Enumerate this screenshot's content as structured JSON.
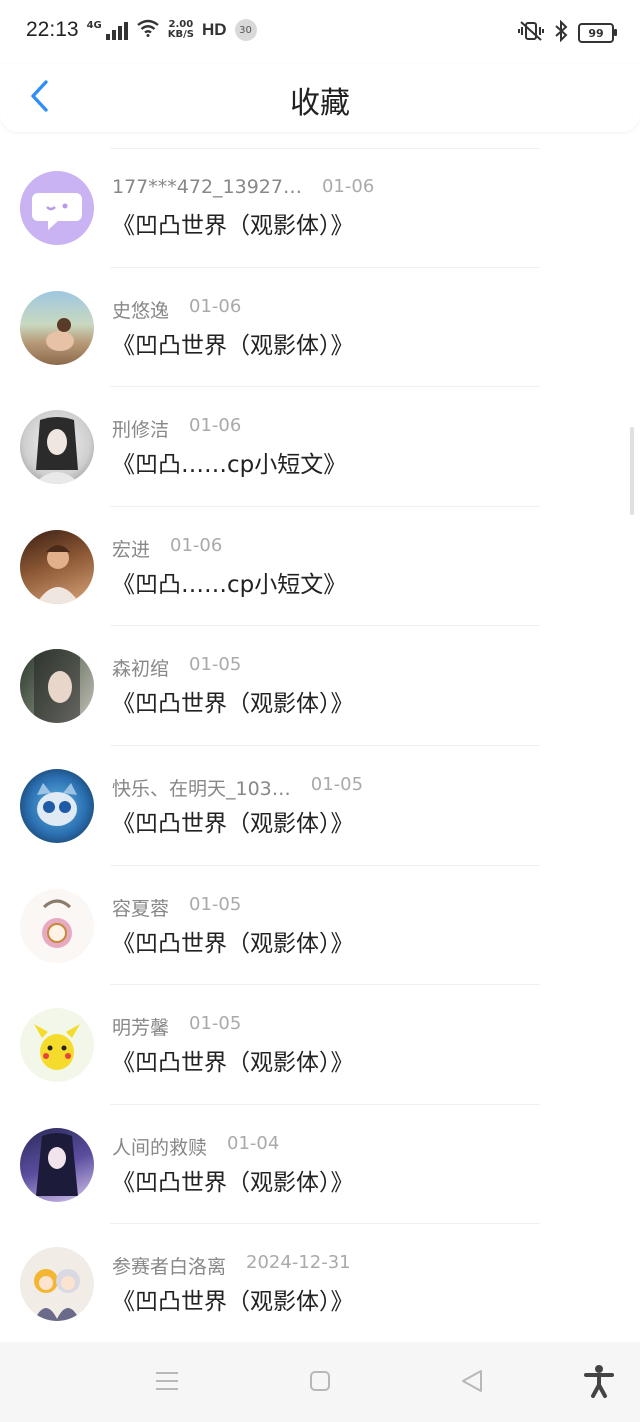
{
  "status_bar": {
    "time": "22:13",
    "network": "4G",
    "speed_value": "2.00",
    "speed_unit": "KB/S",
    "hd": "HD",
    "badge": "30",
    "battery": "99"
  },
  "header": {
    "title": "收藏",
    "back_icon": "chevron-left-icon",
    "accent": "#2f8ef7"
  },
  "items": [
    {
      "name": "177***472_13927…",
      "date": "01-06",
      "title": "《凹凸世界（观影体）》",
      "avatar": "chat-bubble-avatar"
    },
    {
      "name": "史悠逸",
      "date": "01-06",
      "title": "《凹凸世界（观影体）》",
      "avatar": "photo-avatar"
    },
    {
      "name": "刑修洁",
      "date": "01-06",
      "title": "《凹凸……cp小短文》",
      "avatar": "photo-avatar"
    },
    {
      "name": "宏进",
      "date": "01-06",
      "title": "《凹凸……cp小短文》",
      "avatar": "photo-avatar"
    },
    {
      "name": "森初绾",
      "date": "01-05",
      "title": "《凹凸世界（观影体）》",
      "avatar": "photo-avatar"
    },
    {
      "name": "快乐、在明天_103…",
      "date": "01-05",
      "title": "《凹凸世界（观影体）》",
      "avatar": "photo-avatar"
    },
    {
      "name": "容夏蓉",
      "date": "01-05",
      "title": "《凹凸世界（观影体）》",
      "avatar": "photo-avatar"
    },
    {
      "name": "明芳馨",
      "date": "01-05",
      "title": "《凹凸世界（观影体）》",
      "avatar": "photo-avatar"
    },
    {
      "name": "人间的救赎",
      "date": "01-04",
      "title": "《凹凸世界（观影体）》",
      "avatar": "photo-avatar"
    },
    {
      "name": "参赛者白洛离",
      "date": "2024-12-31",
      "title": "《凹凸世界（观影体）》",
      "avatar": "photo-avatar"
    }
  ],
  "nav_bar": {
    "icons": [
      "menu-icon",
      "home-square-icon",
      "back-triangle-icon",
      "accessibility-icon"
    ]
  }
}
